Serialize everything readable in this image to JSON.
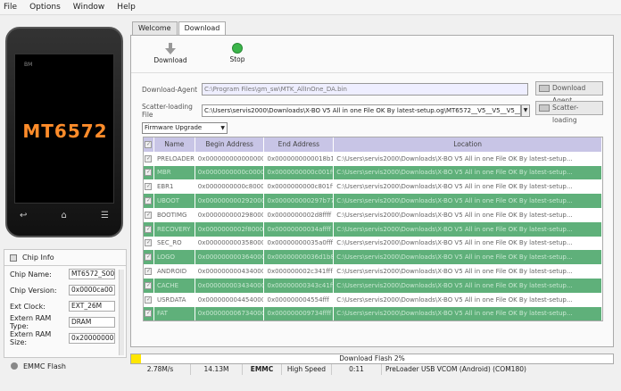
{
  "menu": [
    "File",
    "Options",
    "Window",
    "Help"
  ],
  "phone": {
    "brand": "BM",
    "chip": "MT6572"
  },
  "chip_info": {
    "title": "Chip Info",
    "rows": [
      {
        "label": "Chip Name:",
        "value": "MT6572_S00"
      },
      {
        "label": "Chip Version:",
        "value": "0x0000ca00"
      },
      {
        "label": "Ext Clock:",
        "value": "EXT_26M"
      },
      {
        "label": "Extern RAM Type:",
        "value": "DRAM"
      },
      {
        "label": "Extern RAM Size:",
        "value": "0x20000000"
      }
    ],
    "footer": "EMMC Flash"
  },
  "tabs": [
    "Welcome",
    "Download"
  ],
  "toolbar": {
    "download": "Download",
    "stop": "Stop"
  },
  "download_agent": {
    "label": "Download-Agent",
    "value": "C:\\Program Files\\gm_sw\\MTK_AllInOne_DA.bin",
    "button": "Download Agent"
  },
  "scatter": {
    "label": "Scatter-loading File",
    "value": "C:\\Users\\servis2000\\Downloads\\X-BO V5 All in one File OK By latest-setup.og\\MT6572__V5__V5__V5__4.4.2",
    "button": "Scatter-loading"
  },
  "mode": "Firmware Upgrade",
  "table": {
    "headers": [
      "Name",
      "Begin Address",
      "End Address",
      "Location"
    ],
    "rows": [
      {
        "name": "PRELOADER",
        "begin": "0x0000000000000000",
        "end": "0x0000000000018b17",
        "loc": "C:\\Users\\servis2000\\Downloads\\X-BO V5 All in one File OK By latest-setup..."
      },
      {
        "name": "MBR",
        "begin": "0x0000000000c00000",
        "end": "0x0000000000c001ff",
        "loc": "C:\\Users\\servis2000\\Downloads\\X-BO V5 All in one File OK By latest-setup..."
      },
      {
        "name": "EBR1",
        "begin": "0x0000000000c80000",
        "end": "0x0000000000c801ff",
        "loc": "C:\\Users\\servis2000\\Downloads\\X-BO V5 All in one File OK By latest-setup..."
      },
      {
        "name": "UBOOT",
        "begin": "0x0000000002920000",
        "end": "0x000000000297b77f",
        "loc": "C:\\Users\\servis2000\\Downloads\\X-BO V5 All in one File OK By latest-setup..."
      },
      {
        "name": "BOOTIMG",
        "begin": "0x0000000002980000",
        "end": "0x0000000002d8ffff",
        "loc": "C:\\Users\\servis2000\\Downloads\\X-BO V5 All in one File OK By latest-setup..."
      },
      {
        "name": "RECOVERY",
        "begin": "0x0000000002f80000",
        "end": "0x00000000034affff",
        "loc": "C:\\Users\\servis2000\\Downloads\\X-BO V5 All in one File OK By latest-setup..."
      },
      {
        "name": "SEC_RO",
        "begin": "0x0000000003580000",
        "end": "0x00000000035a0fff",
        "loc": "C:\\Users\\servis2000\\Downloads\\X-BO V5 All in one File OK By latest-setup..."
      },
      {
        "name": "LOGO",
        "begin": "0x0000000003640000",
        "end": "0x00000000036d1b8f",
        "loc": "C:\\Users\\servis2000\\Downloads\\X-BO V5 All in one File OK By latest-setup..."
      },
      {
        "name": "ANDROID",
        "begin": "0x0000000004340000",
        "end": "0x000000002c341fff",
        "loc": "C:\\Users\\servis2000\\Downloads\\X-BO V5 All in one File OK By latest-setup..."
      },
      {
        "name": "CACHE",
        "begin": "0x0000000034340000",
        "end": "0x00000000343c41ff",
        "loc": "C:\\Users\\servis2000\\Downloads\\X-BO V5 All in one File OK By latest-setup..."
      },
      {
        "name": "USRDATA",
        "begin": "0x0000000044540000",
        "end": "0x000000004554fff",
        "loc": "C:\\Users\\servis2000\\Downloads\\X-BO V5 All in one File OK By latest-setup..."
      },
      {
        "name": "FAT",
        "begin": "0x0000000067340000",
        "end": "0x000000009734ffff",
        "loc": "C:\\Users\\servis2000\\Downloads\\X-BO V5 All in one File OK By latest-setup..."
      }
    ]
  },
  "progress": {
    "text": "Download Flash 2%",
    "fraction": 0.02,
    "color": "#ffe600"
  },
  "status": {
    "speed": "2.78M/s",
    "size": "14.13M",
    "type": "EMMC",
    "usb": "High Speed",
    "time": "0:11",
    "port": "PreLoader USB VCOM (Android) (COM180)"
  }
}
